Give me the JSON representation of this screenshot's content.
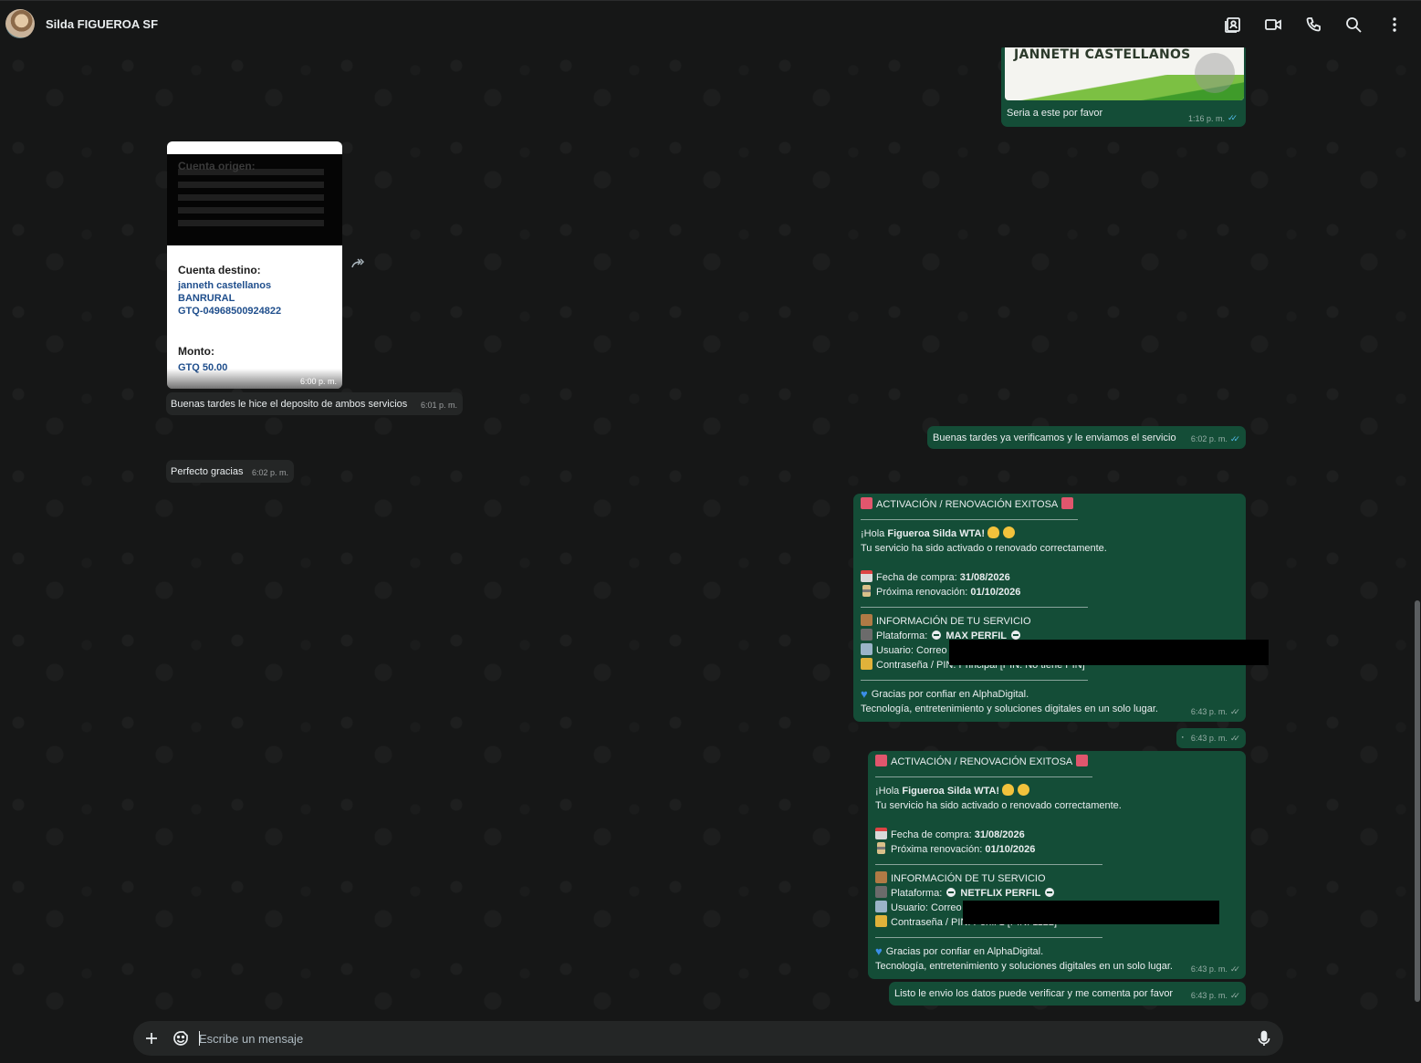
{
  "header": {
    "contact_name": "Silda FIGUEROA SF",
    "icons": [
      "contact-card-icon",
      "video-call-icon",
      "voice-call-icon",
      "search-icon",
      "more-options-icon"
    ]
  },
  "messages": {
    "m1": {
      "image_title": "JANNETH CASTELLANOS",
      "text": "Seria a este por favor",
      "time": "1:16 p. m."
    },
    "m2": {
      "receipt": {
        "origin_label": "Cuenta origen:",
        "dest_label": "Cuenta destino:",
        "dest_name": "janneth castellanos",
        "dest_bank": "BANRURAL",
        "dest_account": "GTQ-04968500924822",
        "amount_label": "Monto:",
        "amount": "GTQ 50.00"
      },
      "time": "6:00 p. m."
    },
    "m3": {
      "text": "Buenas tardes le hice el deposito de ambos servicios",
      "time": "6:01 p. m."
    },
    "m4": {
      "text": "Buenas tardes ya verificamos y le enviamos el servicio",
      "time": "6:02 p. m."
    },
    "m5": {
      "text": "Perfecto gracias",
      "time": "6:02 p. m."
    },
    "m6": {
      "title": "ACTIVACIÓN / RENOVACIÓN EXITOSA",
      "greeting_pre": "¡Hola ",
      "greeting_name": "Figueroa Silda WTA!",
      "activated": "Tu servicio ha sido activado o renovado correctamente.",
      "purchase_label": "Fecha de compra: ",
      "purchase_date": "31/08/2026",
      "renewal_label": "Próxima renovación: ",
      "renewal_date": "01/10/2026",
      "info_title": "INFORMACIÓN DE TU SERVICIO",
      "platform_label": "Plataforma: ",
      "platform": "MAX PERFIL",
      "user_label": "Usuario: Correo",
      "password_label": "Contraseña / PIN: Principal [PIN: No tiene PIN]",
      "thanks": "Gracias por confiar en AlphaDigital.",
      "tagline": "Tecnología, entretenimiento y soluciones digitales en un solo lugar.",
      "time": "6:43 p. m."
    },
    "m7": {
      "text": "·",
      "time": "6:43 p. m."
    },
    "m8": {
      "title": "ACTIVACIÓN / RENOVACIÓN EXITOSA",
      "greeting_pre": "¡Hola ",
      "greeting_name": "Figueroa Silda WTA!",
      "activated": "Tu servicio ha sido activado o renovado correctamente.",
      "purchase_label": "Fecha de compra: ",
      "purchase_date": "31/08/2026",
      "renewal_label": "Próxima renovación: ",
      "renewal_date": "01/10/2026",
      "info_title": "INFORMACIÓN DE TU SERVICIO",
      "platform_label": "Plataforma: ",
      "platform": "NETFLIX PERFIL",
      "user_label": "Usuario: Correo",
      "password_label": "Contraseña / PIN: Perfil 1 [PIN: 1122]",
      "thanks": "Gracias por confiar en AlphaDigital.",
      "tagline": "Tecnología, entretenimiento y soluciones digitales en un solo lugar.",
      "time": "6:43 p. m."
    },
    "m9": {
      "text": "Listo le envio los datos puede verificar y me comenta por favor",
      "time": "6:43 p. m."
    }
  },
  "composer": {
    "placeholder": "Escribe un mensaje",
    "icons": [
      "plus-icon",
      "sticker-icon",
      "microphone-icon"
    ]
  },
  "colors": {
    "background": "#161717",
    "incoming_bubble": "#242626",
    "outgoing_bubble": "#144d37",
    "read_ticks": "#53bdeb"
  }
}
